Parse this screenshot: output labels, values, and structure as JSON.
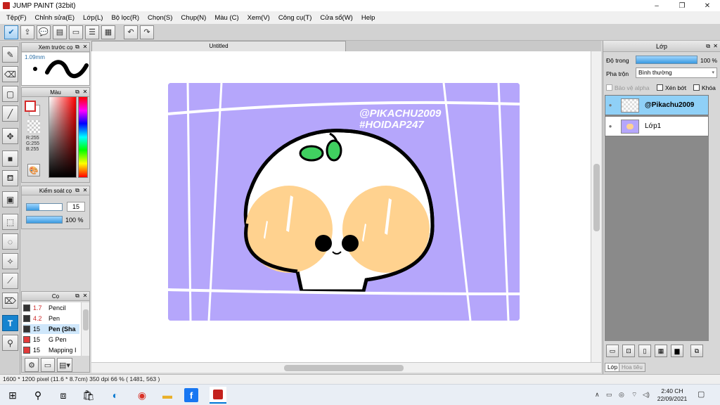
{
  "window": {
    "title": "JUMP PAINT (32bit)",
    "minimize": "–",
    "maximize": "❐",
    "close": "✕"
  },
  "menu": [
    "Tệp(F)",
    "Chỉnh sửa(E)",
    "Lớp(L)",
    "Bộ lọc(R)",
    "Chọn(S)",
    "Chụp(N)",
    "Màu (C)",
    "Xem(V)",
    "Công cụ(T)",
    "Cửa sổ(W)",
    "Help"
  ],
  "panels": {
    "brush_preview": {
      "title": "Xem trước cọ",
      "size": "1.09mm"
    },
    "color": {
      "title": "Màu",
      "rgb": [
        "R:255",
        "G:255",
        "B:255"
      ],
      "fg_color": "#ffffff",
      "bg_color": "#ffffff"
    },
    "control": {
      "title": "Kiểm soát cọ",
      "size_value": "15",
      "opacity_value": "100 %",
      "opacity_fraction": 1.0,
      "size_fraction": 0.35
    },
    "brush": {
      "title": "Cọ",
      "items": [
        {
          "size": "1.7",
          "name": "Pencil",
          "color": "#333333",
          "red": true
        },
        {
          "size": "4.2",
          "name": "Pen",
          "color": "#333333",
          "red": true
        },
        {
          "size": "15",
          "name": "Pen (Sha",
          "color": "#333333",
          "red": false
        },
        {
          "size": "15",
          "name": "G Pen",
          "color": "#e23b3b",
          "red": false
        },
        {
          "size": "15",
          "name": "Mapping I",
          "color": "#e23b3b",
          "red": false
        }
      ]
    }
  },
  "canvas": {
    "tab_title": "Untitled",
    "art_bg": "#b5a6fb",
    "watermark_line1": "@PIKACHU2009",
    "watermark_line2": "#HOIDAP247"
  },
  "layers_panel": {
    "title": "Lớp",
    "opacity_label": "Độ trong",
    "opacity_value": "100 %",
    "opacity_fraction": 1.0,
    "blend_label": "Pha trộn",
    "blend_value": "Bình thường",
    "protect_alpha": "Bảo vệ alpha",
    "clipping": "Xén bớt",
    "lock": "Khóa",
    "layers": [
      {
        "name": "@Pikachu2009",
        "selected": true
      },
      {
        "name": "Lớp1",
        "selected": false
      }
    ],
    "tabs": [
      "Lớp",
      "Hoa tiêu"
    ]
  },
  "status": {
    "text": "1600 * 1200 pixel   (11.6 * 8.7cm)   350 dpi   66 %   ( 1481, 563 )"
  },
  "taskbar": {
    "time": "2:40 CH",
    "date": "22/09/2021"
  }
}
